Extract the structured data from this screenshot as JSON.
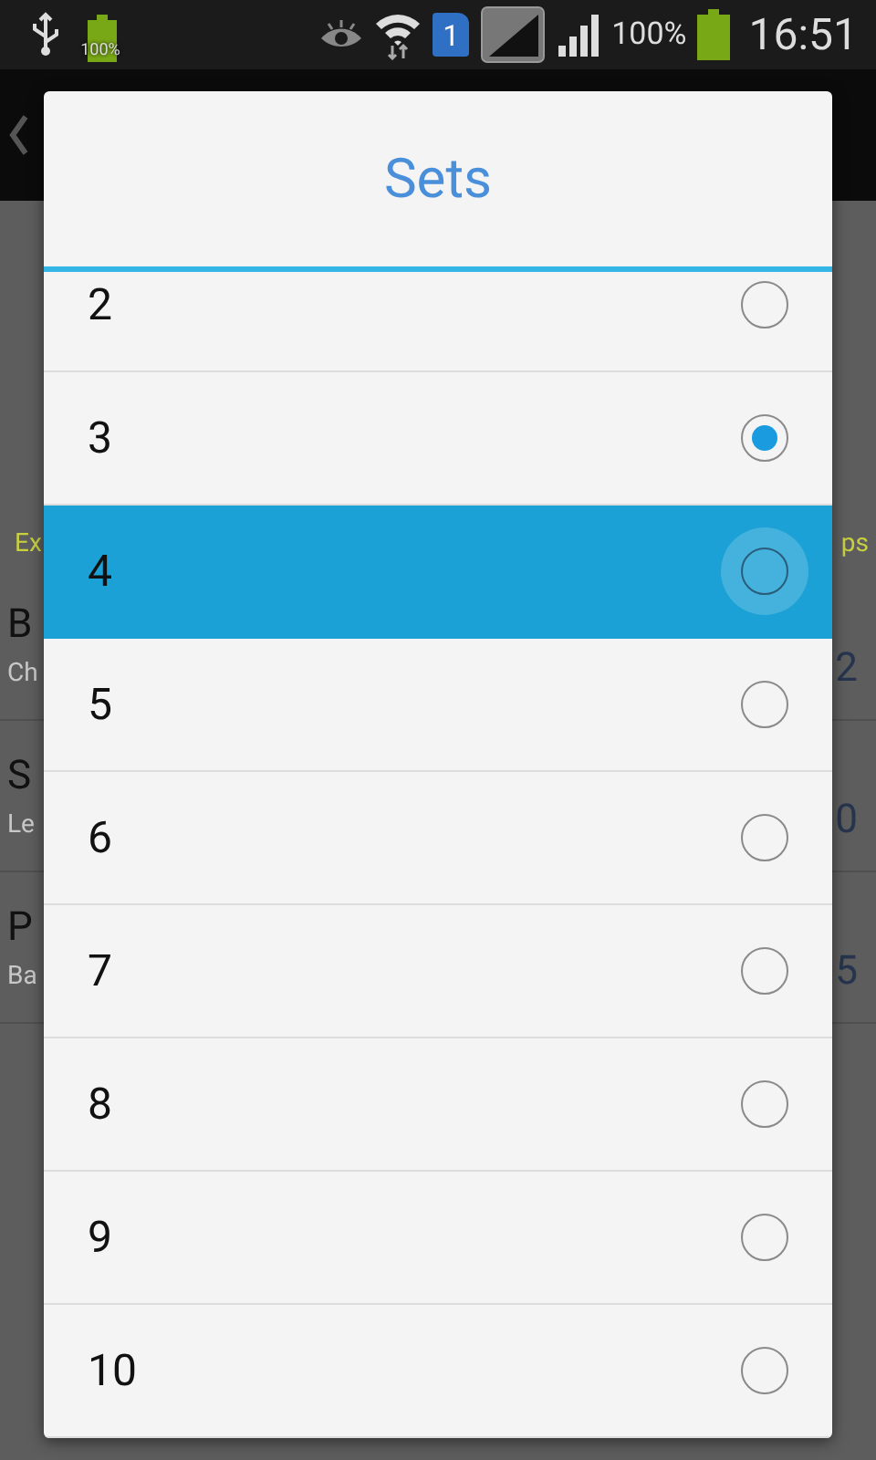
{
  "status_bar": {
    "battery_small_label": "100%",
    "sim_label": "1",
    "battery_percent": "100%",
    "time": "16:51"
  },
  "background": {
    "header": {
      "left": "Ex",
      "right": "ps"
    },
    "rows": [
      {
        "title": "B",
        "subtitle": "Ch",
        "value": "2"
      },
      {
        "title": "S",
        "subtitle": "Le",
        "value": "0"
      },
      {
        "title": "P",
        "subtitle": "Ba",
        "value": "5"
      }
    ]
  },
  "dialog": {
    "title": "Sets",
    "options": [
      {
        "label": "2",
        "selected": false,
        "pressed": false
      },
      {
        "label": "3",
        "selected": true,
        "pressed": false
      },
      {
        "label": "4",
        "selected": false,
        "pressed": true
      },
      {
        "label": "5",
        "selected": false,
        "pressed": false
      },
      {
        "label": "6",
        "selected": false,
        "pressed": false
      },
      {
        "label": "7",
        "selected": false,
        "pressed": false
      },
      {
        "label": "8",
        "selected": false,
        "pressed": false
      },
      {
        "label": "9",
        "selected": false,
        "pressed": false
      },
      {
        "label": "10",
        "selected": false,
        "pressed": false
      }
    ]
  }
}
